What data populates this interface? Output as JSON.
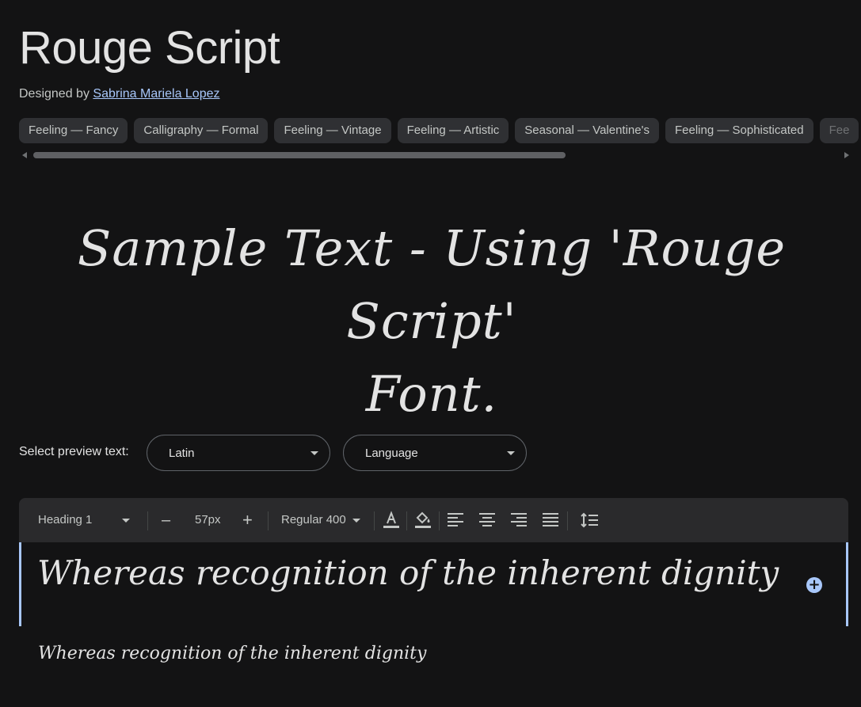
{
  "font": {
    "name": "Rouge Script",
    "designed_by_label": "Designed by",
    "designer": "Sabrina Mariela Lopez"
  },
  "tags": [
    "Feeling — Fancy",
    "Calligraphy — Formal",
    "Feeling — Vintage",
    "Feeling — Artistic",
    "Seasonal — Valentine's",
    "Feeling — Sophisticated",
    "Fee"
  ],
  "hero": {
    "line1": "Sample Text - Using 'Rouge Script'",
    "line2": "Font."
  },
  "preview": {
    "label": "Select preview text:",
    "script_value": "Latin",
    "language_value": "Language"
  },
  "toolbar": {
    "style_value": "Heading 1",
    "decrease_label": "–",
    "size_value": "57px",
    "increase_label": "+",
    "weight_value": "Regular 400"
  },
  "editor": {
    "text": "Whereas recognition of the inherent dignity",
    "add_label": "+"
  },
  "sample_small": "Whereas recognition of the inherent dignity",
  "colors": {
    "background": "#131314",
    "accent": "#a8c7fa",
    "chip": "#2f3033",
    "toolbar": "#2a2a2c"
  }
}
